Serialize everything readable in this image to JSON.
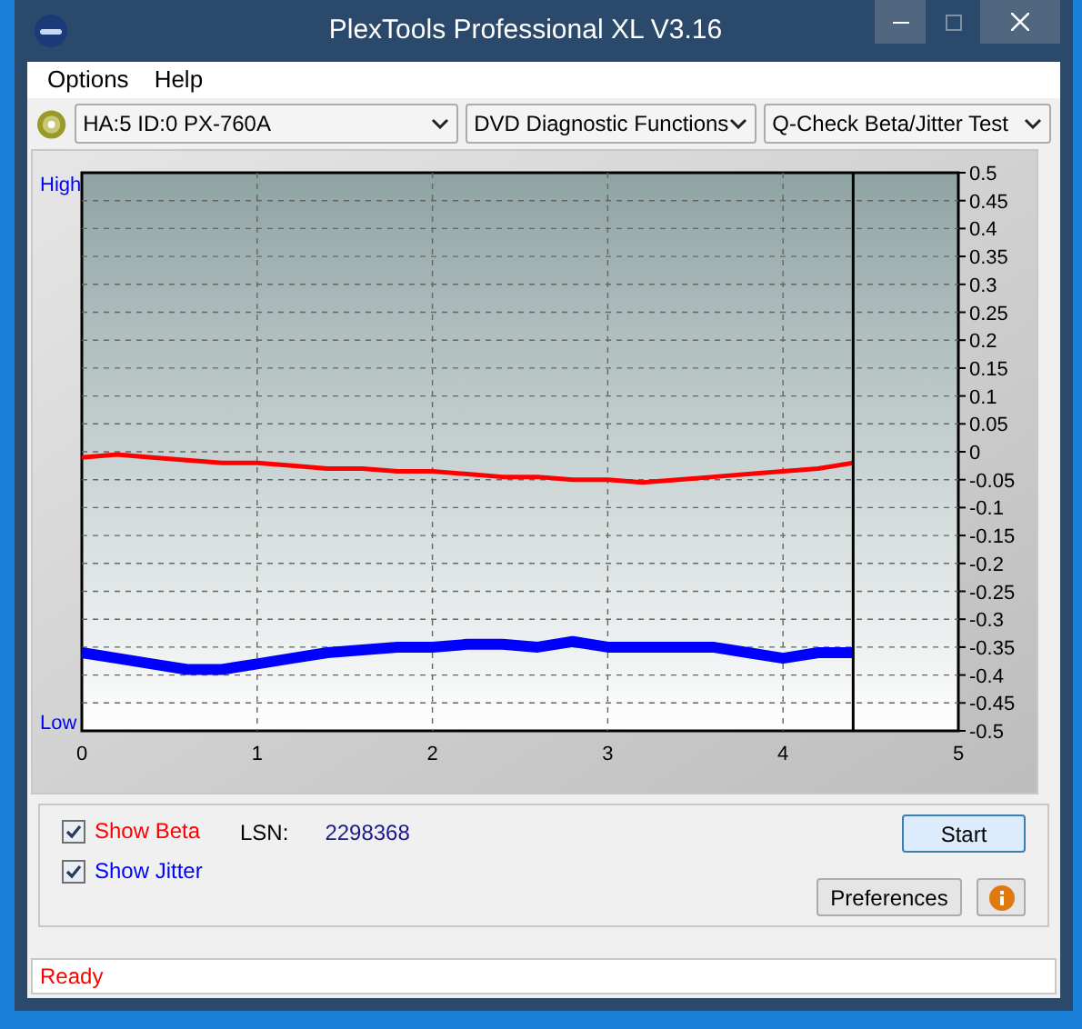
{
  "window": {
    "title": "PlexTools Professional XL V3.16"
  },
  "menu": [
    {
      "label": "Options"
    },
    {
      "label": "Help"
    }
  ],
  "toolbar": {
    "drive": "HA:5 ID:0  PX-760A",
    "category": "DVD Diagnostic Functions",
    "test": "Q-Check Beta/Jitter Test"
  },
  "chart": {
    "high_label": "High",
    "low_label": "Low",
    "chart_data": {
      "type": "line",
      "x": [
        0,
        0.2,
        0.4,
        0.6,
        0.8,
        1,
        1.2,
        1.4,
        1.6,
        1.8,
        2,
        2.2,
        2.4,
        2.6,
        2.8,
        3,
        3.2,
        3.4,
        3.6,
        3.8,
        4,
        4.2,
        4.4
      ],
      "series": [
        {
          "color": "#ff0000",
          "values": [
            -0.01,
            -0.005,
            -0.01,
            -0.015,
            -0.02,
            -0.02,
            -0.025,
            -0.03,
            -0.03,
            -0.035,
            -0.035,
            -0.04,
            -0.045,
            -0.045,
            -0.05,
            -0.05,
            -0.055,
            -0.05,
            -0.045,
            -0.04,
            -0.035,
            -0.03,
            -0.02
          ]
        },
        {
          "color": "#0000ff",
          "values": [
            -0.36,
            -0.37,
            -0.38,
            -0.39,
            -0.39,
            -0.38,
            -0.37,
            -0.36,
            -0.355,
            -0.35,
            -0.35,
            -0.345,
            -0.345,
            -0.35,
            -0.34,
            -0.35,
            -0.35,
            -0.35,
            -0.35,
            -0.36,
            -0.37,
            -0.36,
            -0.36
          ]
        }
      ],
      "grid": true,
      "ref_lines": [
        {
          "axis": "x",
          "value": 4.4
        }
      ],
      "xlim": [
        0,
        5
      ],
      "ylim": [
        -0.5,
        0.5
      ],
      "xticks": [
        0,
        1,
        2,
        3,
        4,
        5
      ],
      "yticks": [
        0.5,
        0.45,
        0.4,
        0.35,
        0.3,
        0.25,
        0.2,
        0.15,
        0.1,
        0.05,
        0,
        -0.05,
        -0.1,
        -0.15,
        -0.2,
        -0.25,
        -0.3,
        -0.35,
        -0.4,
        -0.45,
        -0.5
      ]
    }
  },
  "options": [
    {
      "label": "Show Beta",
      "checked": true,
      "color": "#ff0000"
    },
    {
      "label": "Show Jitter",
      "checked": true,
      "color": "#0000ff"
    }
  ],
  "lsn": {
    "label": "LSN:",
    "value": "2298368"
  },
  "buttons": {
    "start": "Start",
    "preferences": "Preferences"
  },
  "status_bar": "Ready"
}
